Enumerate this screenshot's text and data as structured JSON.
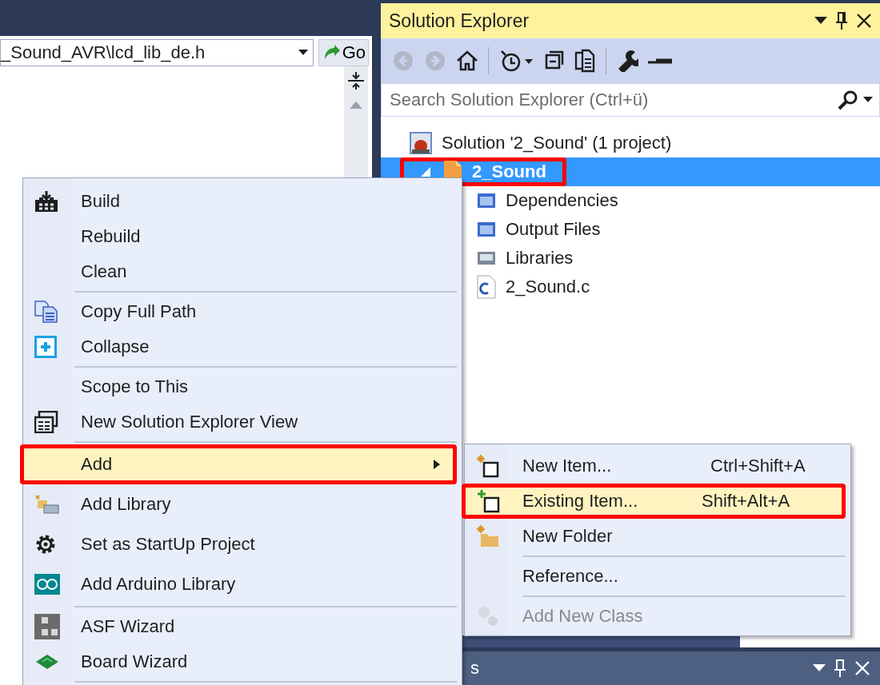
{
  "editor": {
    "file_path": "_Sound_AVR\\lcd_lib_de.h",
    "go_button": "Go"
  },
  "solution_explorer": {
    "title": "Solution Explorer",
    "search": {
      "placeholder": "Search Solution Explorer (Ctrl+ü)"
    },
    "tree": [
      {
        "label": "Solution '2_Sound' (1 project)",
        "selected": false,
        "marked": false,
        "children": [
          {
            "label": "2_Sound",
            "selected": true,
            "marked": true,
            "expanded": true,
            "children": [
              {
                "label": "Dependencies",
                "selected": false,
                "marked": false
              },
              {
                "label": "Output Files",
                "selected": false,
                "marked": false
              },
              {
                "label": "Libraries",
                "selected": false,
                "marked": false
              },
              {
                "label": "2_Sound.c",
                "selected": false,
                "marked": false
              }
            ]
          }
        ]
      }
    ]
  },
  "bottom_panel": {
    "title": "s"
  },
  "context_menu": {
    "groups": [
      [
        {
          "label": "Build",
          "selected": false,
          "marked": false,
          "submenu": false
        },
        {
          "label": "Rebuild",
          "selected": false,
          "marked": false,
          "submenu": false
        },
        {
          "label": "Clean",
          "selected": false,
          "marked": false,
          "submenu": false
        }
      ],
      [
        {
          "label": "Copy Full Path",
          "selected": false,
          "marked": false,
          "submenu": false
        },
        {
          "label": "Collapse",
          "selected": false,
          "marked": false,
          "submenu": false
        }
      ],
      [
        {
          "label": "Scope to This",
          "selected": false,
          "marked": false,
          "submenu": false
        },
        {
          "label": "New Solution Explorer View",
          "selected": false,
          "marked": false,
          "submenu": false
        }
      ],
      [
        {
          "label": "Add",
          "selected": true,
          "marked": true,
          "submenu": true
        },
        {
          "label": "Add Library",
          "selected": false,
          "marked": false,
          "submenu": false
        },
        {
          "label": "Set as StartUp Project",
          "selected": false,
          "marked": false,
          "submenu": false
        },
        {
          "label": "Add Arduino Library",
          "selected": false,
          "marked": false,
          "submenu": false
        }
      ],
      [
        {
          "label": "ASF Wizard",
          "selected": false,
          "marked": false,
          "submenu": false
        },
        {
          "label": "Board Wizard",
          "selected": false,
          "marked": false,
          "submenu": false
        }
      ]
    ]
  },
  "submenu": {
    "groups": [
      [
        {
          "label": "New Item...",
          "shortcut": "Ctrl+Shift+A",
          "selected": false,
          "marked": false,
          "disabled": false
        },
        {
          "label": "Existing Item...",
          "shortcut": "Shift+Alt+A",
          "selected": true,
          "marked": true,
          "disabled": false
        },
        {
          "label": "New Folder",
          "selected": false,
          "marked": false,
          "disabled": false
        }
      ],
      [
        {
          "label": "Reference...",
          "selected": false,
          "marked": false,
          "disabled": false
        }
      ],
      [
        {
          "label": "Add New Class",
          "selected": false,
          "marked": false,
          "disabled": true
        }
      ]
    ]
  }
}
